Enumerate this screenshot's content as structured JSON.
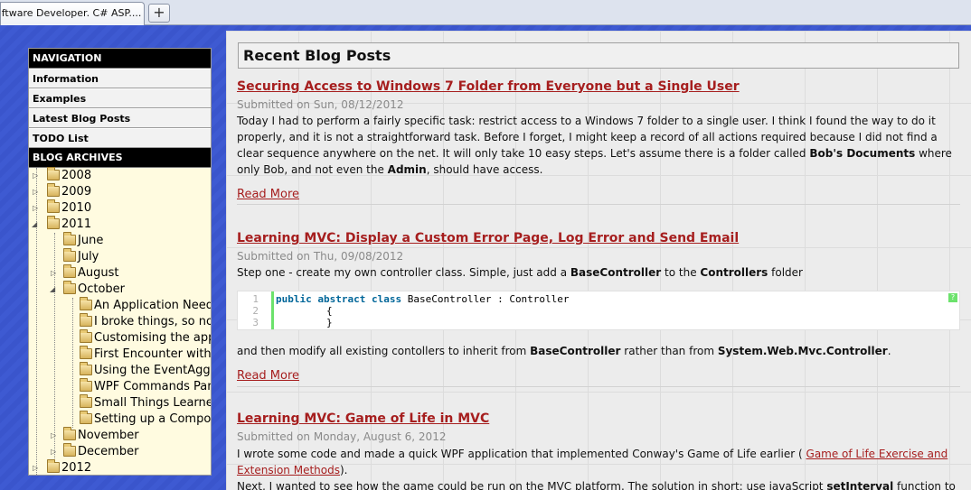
{
  "browser": {
    "tab_title": "oftware Developer. C# ASP....",
    "new_tab_label": "+"
  },
  "sidebar": {
    "navigation_heading": "NAVIGATION",
    "nav_items": [
      "Information",
      "Examples",
      "Latest Blog Posts",
      "TODO List"
    ],
    "archives_heading": "BLOG ARCHIVES",
    "tree": {
      "y2008": "2008",
      "y2009": "2009",
      "y2010": "2010",
      "y2011": "2011",
      "june": "June",
      "july": "July",
      "august": "August",
      "october": "October",
      "oct_posts": [
        "An Application Need",
        "I broke things, so no",
        "Customising the app",
        "First Encounter with",
        "Using the EventAggr",
        "WPF Commands Part",
        "Small Things Learned",
        "Setting up a Compos"
      ],
      "november": "November",
      "december": "December",
      "y2012": "2012"
    }
  },
  "main": {
    "heading": "Recent Blog Posts",
    "posts": [
      {
        "title": "Securing Access to Windows 7 Folder from Everyone but a Single User",
        "submitted": "Submitted on Sun, 08/12/2012",
        "body_1": "Today I had to perform a fairly specific task: restrict access to a Windows 7 folder to a single user. I think I found the way to do it properly, and it is not a straightforward task. Before I forget, I might keep a record of all actions required because I did not find a clear sequence anywhere on the net. It will only take 10 easy steps. Let's assume there is a folder called ",
        "bold_1": "Bob's Documents",
        "body_2": " where only Bob, and not even the ",
        "bold_2": "Admin",
        "body_3": ", should have access.",
        "read_more": "Read More"
      },
      {
        "title": "Learning MVC: Display a Custom Error Page, Log Error and Send Email",
        "submitted": "Submitted on Thu, 09/08/2012",
        "intro_1": "Step one - create my own controller class. Simple, just add a ",
        "intro_bold_1": "BaseController",
        "intro_2": " to the ",
        "intro_bold_2": "Controllers",
        "intro_3": " folder",
        "code": {
          "line_numbers": [
            "1",
            "2",
            "3"
          ],
          "kw_public": "public",
          "kw_abstract": "abstract",
          "kw_class": "class",
          "decl_rest": " BaseController : Controller",
          "line2": "{",
          "line3": "}",
          "help_icon": "?"
        },
        "after_1": "and then modify all existing contollers to inherit from ",
        "after_bold_1": "BaseController",
        "after_2": " rather than from ",
        "after_bold_2": "System.Web.Mvc.Controller",
        "after_3": ".",
        "read_more": "Read More"
      },
      {
        "title": "Learning MVC: Game of Life in MVC",
        "submitted": "Submitted on Monday, August 6, 2012",
        "body_1": "I wrote some code and made a quick WPF application that implemented Conway's Game of Life earlier ( ",
        "link": "Game of Life Exercise and Extension Methods",
        "body_2": ").",
        "body_3": "Next, I wanted to see how the game could be run on the MVC platform. The solution in short: use javaScript ",
        "bold_1": "setInterval",
        "body_4": " function to load"
      }
    ]
  }
}
